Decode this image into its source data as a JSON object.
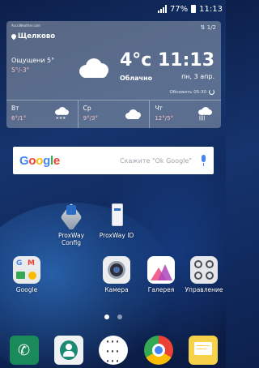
{
  "status": {
    "battery": "77%",
    "time": "11:13"
  },
  "weather": {
    "source": "AccuWeather.com",
    "page": "1/2",
    "city": "Щелково",
    "feels_like": "Ощущени 5°",
    "range": "5°/-3°",
    "temp": "4°c",
    "condition": "Облачно",
    "time": "11:13",
    "date": "пн, 3 апр.",
    "updated": "Обновить 05:30",
    "forecast": [
      {
        "day": "Вт",
        "range": "6°/1°",
        "icon": "snow-cloud-icon"
      },
      {
        "day": "Ср",
        "range": "9°/3°",
        "icon": "cloud-icon"
      },
      {
        "day": "Чт",
        "range": "12°/5°",
        "icon": "rain-cloud-icon"
      }
    ]
  },
  "google": {
    "logo": "Google",
    "hint": "Скажите \"Ok Google\""
  },
  "apps": {
    "proxway_config": "ProxWay Config",
    "proxway_id": "ProxWay ID",
    "google": "Google",
    "camera": "Камера",
    "gallery": "Галерея",
    "manage": "Управление"
  },
  "pages": {
    "count": 2,
    "current": 1
  },
  "dock": [
    "phone-icon",
    "contacts-icon",
    "apps-drawer-icon",
    "chrome-icon",
    "messages-icon"
  ]
}
